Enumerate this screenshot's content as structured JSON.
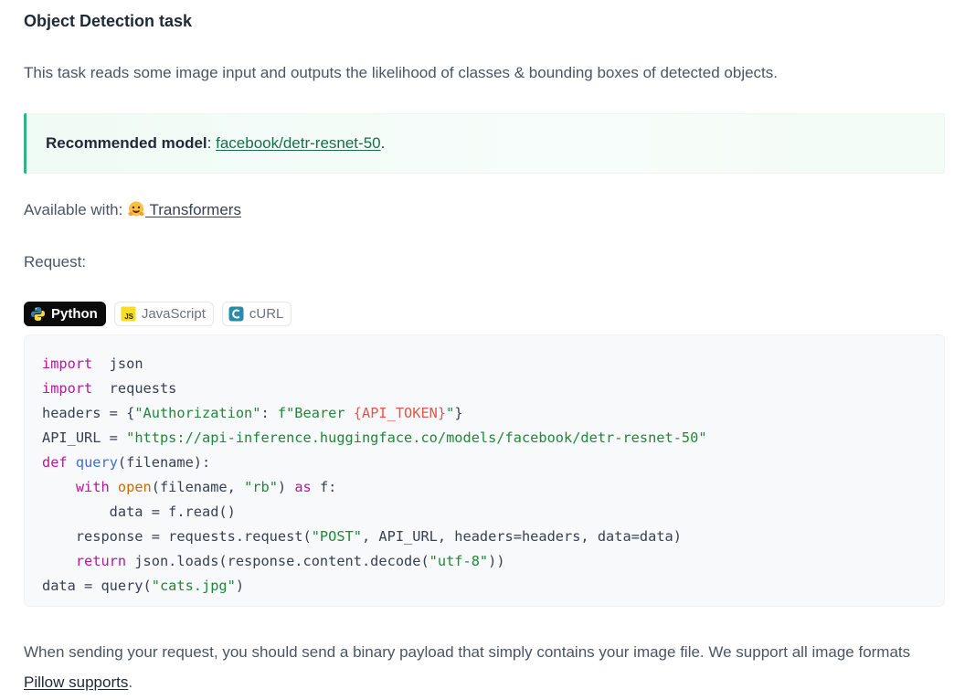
{
  "heading": "Object Detection task",
  "description": "This task reads some image input and outputs the likelihood of classes & bounding boxes of detected objects.",
  "callout": {
    "label": "Recommended model",
    "separator": ": ",
    "model_link": "facebook/detr-resnet-50",
    "end": "."
  },
  "available": {
    "prefix": "Available with: ",
    "library": "Transformers",
    "icon": "hugging-face-emoji-icon"
  },
  "request_label": "Request:",
  "tabs": [
    {
      "label": "Python",
      "icon": "python-icon",
      "active": true
    },
    {
      "label": "JavaScript",
      "icon": "javascript-icon",
      "active": false
    },
    {
      "label": "cURL",
      "icon": "curl-icon",
      "active": false
    }
  ],
  "code_lines": [
    [
      [
        "kw",
        "import"
      ],
      [
        "",
        "  json"
      ]
    ],
    [
      [
        "kw",
        "import"
      ],
      [
        "",
        "  requests"
      ]
    ],
    [
      [
        "",
        "headers = {"
      ],
      [
        "str",
        "\"Authorization\""
      ],
      [
        "",
        ": "
      ],
      [
        "str",
        "f\"Bearer "
      ],
      [
        "interp",
        "{API_TOKEN}"
      ],
      [
        "str",
        "\""
      ],
      [
        "",
        "}"
      ]
    ],
    [
      [
        "",
        "API_URL = "
      ],
      [
        "str",
        "\"https://api-inference.huggingface.co/models/facebook/detr-resnet-50\""
      ]
    ],
    [
      [
        "kw",
        "def"
      ],
      [
        "",
        " "
      ],
      [
        "fn",
        "query"
      ],
      [
        "",
        "(filename):"
      ]
    ],
    [
      [
        "",
        "    "
      ],
      [
        "kw",
        "with"
      ],
      [
        "",
        " "
      ],
      [
        "bi",
        "open"
      ],
      [
        "",
        "(filename, "
      ],
      [
        "str",
        "\"rb\""
      ],
      [
        "",
        ") "
      ],
      [
        "kw",
        "as"
      ],
      [
        "",
        " f:"
      ]
    ],
    [
      [
        "",
        "        data = f.read()"
      ]
    ],
    [
      [
        "",
        "    response = requests.request("
      ],
      [
        "str",
        "\"POST\""
      ],
      [
        "",
        ", API_URL, headers=headers, data=data)"
      ]
    ],
    [
      [
        "",
        "    "
      ],
      [
        "kw",
        "return"
      ],
      [
        "",
        " json.loads(response.content.decode("
      ],
      [
        "str",
        "\"utf-8\""
      ],
      [
        "",
        "))"
      ]
    ],
    [
      [
        "",
        "data = query("
      ],
      [
        "str",
        "\"cats.jpg\""
      ],
      [
        "",
        ")"
      ]
    ]
  ],
  "footer": {
    "text": "When sending your request, you should send a binary payload that simply contains your image file. We support all image formats ",
    "link": "Pillow supports",
    "end": "."
  },
  "colors": {
    "accent": "#34b388",
    "link_green": "#166e4e",
    "keyword": "#b5189a",
    "string": "#22863a",
    "function": "#3b6fd4"
  }
}
